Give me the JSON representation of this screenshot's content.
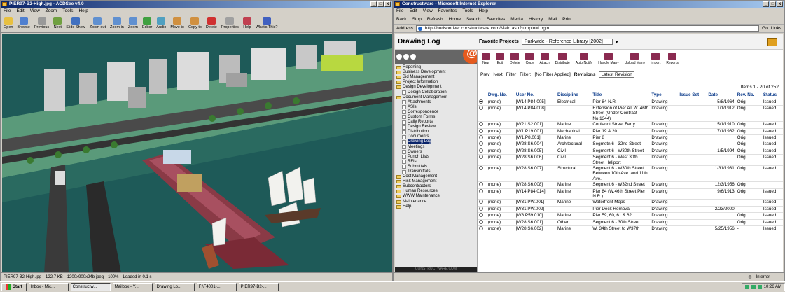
{
  "acdsee": {
    "title": "PIER97-B2-High.jpg - ACDSee v4.0",
    "menu": [
      "File",
      "Edit",
      "View",
      "Zoom",
      "Tools",
      "Help"
    ],
    "toolbar": [
      "Open",
      "Browse",
      "Previous",
      "Next",
      "Slide Show",
      "Zoom out",
      "Zoom in",
      "Zoom",
      "Editor",
      "Audio",
      "Move to",
      "Copy to",
      "Delete",
      "Properties",
      "Help",
      "What's This?"
    ],
    "status": {
      "file": "PIER97-B2-High.jpg",
      "size": "122.7 KB",
      "dims": "1200x900x24b jpeg",
      "zoom": "100%",
      "loaded": "Loaded in 0.1 s"
    }
  },
  "ie": {
    "title": "Constructware - Microsoft Internet Explorer",
    "menu": [
      "File",
      "Edit",
      "View",
      "Favorites",
      "Tools",
      "Help"
    ],
    "toolbar": [
      "Back",
      "Stop",
      "Refresh",
      "Home",
      "Search",
      "Favorites",
      "Media",
      "History",
      "Mail",
      "Print"
    ],
    "address_label": "Address",
    "address": "http://hudsonriver.constructware.com/Main.asp?jumpto=Login",
    "go": "Go",
    "links": "Links",
    "status_zone": "Internet"
  },
  "app": {
    "page_title": "Drawing Log",
    "favorites_label": "Favorite Projects",
    "project": "Parkwide - Reference Library [2002]",
    "favorites_button": "Favorites",
    "logo_letter": "@",
    "footer": "CONSTRUCTWARE.COM",
    "nav": [
      {
        "label": "Reporting",
        "level": 1
      },
      {
        "label": "Business Development",
        "level": 1
      },
      {
        "label": "Bid Management",
        "level": 1
      },
      {
        "label": "Project Information",
        "level": 1
      },
      {
        "label": "Design Development",
        "level": 1
      },
      {
        "label": "Design Collaboration",
        "level": 2
      },
      {
        "label": "Document Management",
        "level": 1
      },
      {
        "label": "Attachments",
        "level": 2
      },
      {
        "label": "ASIs",
        "level": 2
      },
      {
        "label": "Correspondence",
        "level": 2
      },
      {
        "label": "Custom Forms",
        "level": 2
      },
      {
        "label": "Daily Reports",
        "level": 2
      },
      {
        "label": "Design Review",
        "level": 2
      },
      {
        "label": "Distribution",
        "level": 2
      },
      {
        "label": "Documents",
        "level": 2
      },
      {
        "label": "Drawing Log",
        "level": 2,
        "selected": true
      },
      {
        "label": "Meetings",
        "level": 2
      },
      {
        "label": "Owners",
        "level": 2
      },
      {
        "label": "Punch Lists",
        "level": 2
      },
      {
        "label": "RFIs",
        "level": 2
      },
      {
        "label": "Submittals",
        "level": 2
      },
      {
        "label": "Transmittals",
        "level": 2
      },
      {
        "label": "Cost Management",
        "level": 1
      },
      {
        "label": "Risk Management",
        "level": 1
      },
      {
        "label": "Subcontractors",
        "level": 1
      },
      {
        "label": "Human Resources",
        "level": 1
      },
      {
        "label": "WWW Maintenance",
        "level": 1
      },
      {
        "label": "Maintenance",
        "level": 1
      },
      {
        "label": "Help",
        "level": 1
      }
    ],
    "actions": [
      "New",
      "Edit",
      "Delete",
      "Copy",
      "Attach",
      "Distribute",
      "Auto Notify",
      "Handle Many",
      "Upload Many",
      "Import",
      "Reports"
    ],
    "filter_nav": [
      "Prev",
      "Next",
      "Filter"
    ],
    "filter_label": "Filter:",
    "filter_value": "[No Filter Applied]",
    "revisions_label": "Revisions",
    "revisions_value": "Latest Revision",
    "items_count": "Items 1 - 20 of 252",
    "columns": [
      "Dwg. No.",
      "User No.",
      "Discipline",
      "Title",
      "Type",
      "Issue Set",
      "Date",
      "Rev. No.",
      "Status"
    ],
    "rows": [
      {
        "dwg": "(none)",
        "user": "[W14.P84.005]",
        "disc": "Electrical",
        "title": "Pier 84 N.R.",
        "type": "Drawing",
        "set": "",
        "date": "5/8/1964",
        "rev": "Orig",
        "status": "Issued",
        "sel": true
      },
      {
        "dwg": "(none)",
        "user": "[W14.P84.008]",
        "disc": "",
        "title": "Extension of Pier AT W. 46th Street (Under Contract No.1344)",
        "type": "Drawing",
        "set": "",
        "date": "1/1/1912",
        "rev": "Orig",
        "status": "Issued"
      },
      {
        "dwg": "(none)",
        "user": "[W21.S2.001]",
        "disc": "Marine",
        "title": "Cortlandt Street Ferry",
        "type": "Drawing",
        "set": "",
        "date": "5/1/1910",
        "rev": "Orig",
        "status": "Issued"
      },
      {
        "dwg": "(none)",
        "user": "[W1.P19.001]",
        "disc": "Mechanical",
        "title": "Pier 19 & 20",
        "type": "Drawing",
        "set": "",
        "date": "7/1/1962",
        "rev": "Orig",
        "status": "Issued"
      },
      {
        "dwg": "(none)",
        "user": "[W1.P8.001]",
        "disc": "Marine",
        "title": "Pier 8",
        "type": "Drawing",
        "set": "",
        "date": "",
        "rev": "Orig",
        "status": "Issued"
      },
      {
        "dwg": "(none)",
        "user": "[W28.S6.004]",
        "disc": "Architectural",
        "title": "Segmetn 6 - 32nd Street",
        "type": "Drawing",
        "set": "",
        "date": "",
        "rev": "Orig",
        "status": "Issued"
      },
      {
        "dwg": "(none)",
        "user": "[W28.S6.005]",
        "disc": "Civil",
        "title": "Segment 6 - W30th Street",
        "type": "Drawing",
        "set": "",
        "date": "1/5/1994",
        "rev": "Orig",
        "status": "Issued"
      },
      {
        "dwg": "(none)",
        "user": "[W28.S6.006]",
        "disc": "Civil",
        "title": "Segment 6 - West 30th Street Heliport",
        "type": "Drawing",
        "set": "",
        "date": "",
        "rev": "Orig",
        "status": "Issued"
      },
      {
        "dwg": "(none)",
        "user": "[W28.S6.007]",
        "disc": "Structural",
        "title": "Segment 6 - W30th Street Between 10th Ave. and 11th Ave.",
        "type": "Drawing",
        "set": "",
        "date": "1/31/1931",
        "rev": "Orig",
        "status": "Issued"
      },
      {
        "dwg": "(none)",
        "user": "[W28.S6.008]",
        "disc": "Marine",
        "title": "Segment 6 - W32nd Street",
        "type": "Drawing",
        "set": "",
        "date": "12/3/1956",
        "rev": "Orig",
        "status": ""
      },
      {
        "dwg": "(none)",
        "user": "[W14.P84.014]",
        "disc": "Marine",
        "title": "Pier 84 (W.46th Street Pier N.R.)",
        "type": "Drawing",
        "set": "",
        "date": "9/6/1913",
        "rev": "Orig",
        "status": "Issued"
      },
      {
        "dwg": "(none)",
        "user": "[W31.PW.001]",
        "disc": "Marine",
        "title": "Waterfront Maps",
        "type": "Drawing -",
        "set": "",
        "date": "",
        "rev": "-",
        "status": "Issued"
      },
      {
        "dwg": "(none)",
        "user": "[W31.PW.002]",
        "disc": "",
        "title": "Pier Deck Removal",
        "type": "Drawing -",
        "set": "",
        "date": "2/23/2000",
        "rev": "-",
        "status": "Issued"
      },
      {
        "dwg": "(none)",
        "user": "[W8.P59.010]",
        "disc": "Marine",
        "title": "Pier 59, 60, 61 & 62",
        "type": "Drawing",
        "set": "",
        "date": "",
        "rev": "Orig",
        "status": "Issued"
      },
      {
        "dwg": "(none)",
        "user": "[W28.S6.001]",
        "disc": "Other",
        "title": "Segment 6 - 30th Street",
        "type": "Drawing",
        "set": "",
        "date": "",
        "rev": "Orig",
        "status": "Issued"
      },
      {
        "dwg": "(none)",
        "user": "[W28.S6.002]",
        "disc": "Marine",
        "title": "W. 34th Street to W37th",
        "type": "Drawing",
        "set": "",
        "date": "5/25/1956",
        "rev": "-",
        "status": "Issued"
      }
    ]
  },
  "taskbar": {
    "start": "Start",
    "tasks": [
      "Inbox - Mic...",
      "Constructw...",
      "Mailbox - Y...",
      "Drawing Lo...",
      "F:\\F4001-...",
      "PIER97-B2-..."
    ],
    "active": 1,
    "clock": "10:26 AM"
  },
  "colors": {
    "water": "#1e5a58",
    "land": "#5a9a7a",
    "pier": "#8a3a46",
    "accent": "#e55a1e",
    "link": "#0a3a8a"
  }
}
